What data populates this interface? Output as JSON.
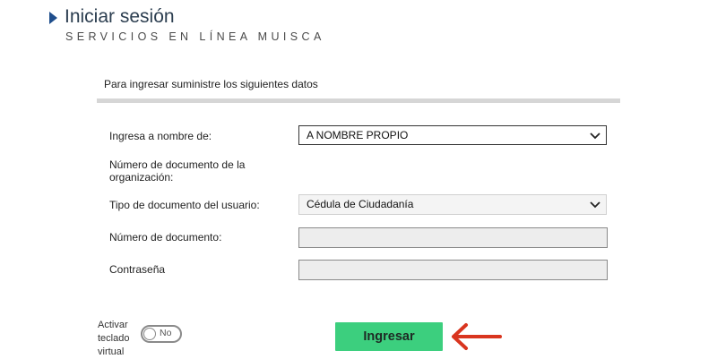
{
  "header": {
    "title": "Iniciar sesión",
    "subtitle": "SERVICIOS EN LÍNEA MUISCA",
    "icon": "triangle-right-icon",
    "accent_color": "#1f4e8c"
  },
  "panel": {
    "heading": "Para ingresar suministre los siguientes datos"
  },
  "form": {
    "on_behalf_label": "Ingresa a nombre de:",
    "on_behalf_value": "A NOMBRE PROPIO",
    "org_doc_label": "Número de documento de la organización:",
    "user_doc_type_label": "Tipo de documento del usuario:",
    "user_doc_type_value": "Cédula de Ciudadanía",
    "doc_number_label": "Número de documento:",
    "doc_number_value": "",
    "password_label": "Contraseña",
    "password_value": ""
  },
  "virtual_keyboard": {
    "label_line1": "Activar",
    "label_line2": "teclado",
    "label_line3": "virtual",
    "toggle_text": "No",
    "enabled": false
  },
  "actions": {
    "submit_label": "Ingresar",
    "submit_color": "#3ccf7e",
    "annotation_arrow_color": "#d9351f"
  }
}
